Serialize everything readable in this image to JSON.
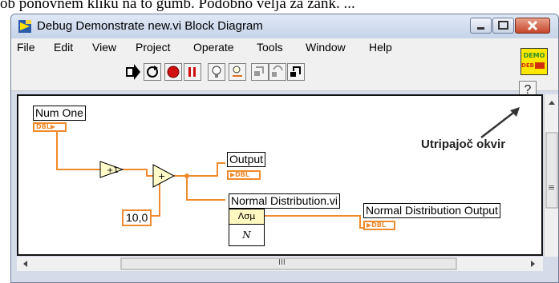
{
  "doc_text": "ob ponovnem kliku na to gumb. Podobno velja za zank. ...",
  "window": {
    "title": "Debug Demonstrate new.vi Block Diagram"
  },
  "menu": [
    "File",
    "Edit",
    "View",
    "Project",
    "Operate",
    "Tools",
    "Window",
    "Help"
  ],
  "toolbar": {
    "buttons": [
      "run",
      "run-continuously",
      "abort",
      "pause",
      "highlight-execution",
      "retain-wire-values",
      "step-into",
      "step-over",
      "step-out"
    ],
    "help_label": "?"
  },
  "vi_icon": {
    "line1": "DEMO",
    "line2": "DEB"
  },
  "diagram": {
    "num_one": "Num One",
    "dbl": "DBL",
    "increment": "+1",
    "add": "+",
    "constant": "10,0",
    "output": "Output",
    "normal_vi": "Normal Distribution.vi",
    "normal_symbol": "Λσμ",
    "normal_n": "N",
    "normal_output": "Normal Distribution Output"
  },
  "annotation": "Utripajoč okvir",
  "scroll": {
    "grip": "III",
    "vgrip": "≡"
  },
  "colors": {
    "wire": "#f08a2c",
    "canvas_border": "#111111"
  }
}
